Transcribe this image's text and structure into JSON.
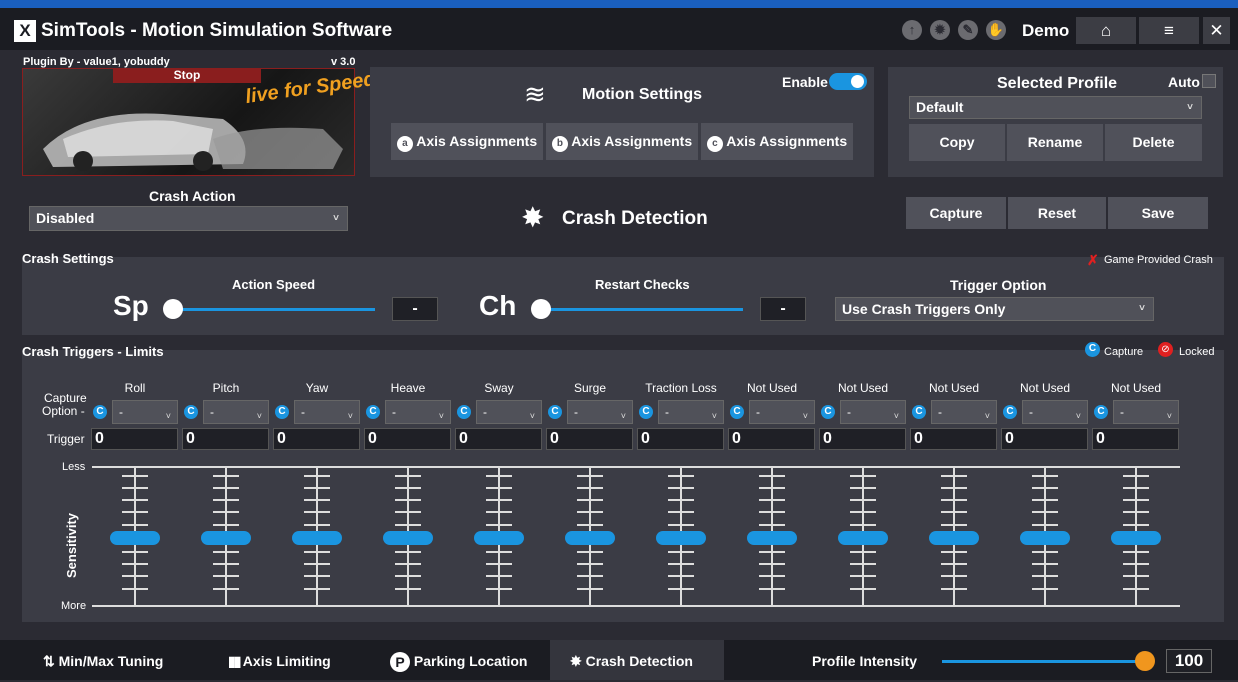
{
  "app": {
    "logo_letter": "X",
    "title": "SimTools - Motion Simulation Software",
    "user": "Demo",
    "icons": [
      "arrow-up-icon",
      "gear-icon",
      "pencil-icon",
      "hand-icon"
    ],
    "home_icon": "⌂",
    "menu_icon": "≡",
    "close_icon": "✕"
  },
  "plugin": {
    "by": "Plugin By - value1, yobuddy",
    "version": "v 3.0",
    "status": "Stop",
    "logo_text": "live for Speed"
  },
  "motion": {
    "title": "Motion Settings",
    "enable_label": "Enable",
    "enabled": true,
    "axis_buttons": [
      {
        "letter": "a",
        "label": "Axis Assignments"
      },
      {
        "letter": "b",
        "label": "Axis Assignments"
      },
      {
        "letter": "c",
        "label": "Axis Assignments"
      }
    ]
  },
  "profile": {
    "title": "Selected Profile",
    "auto_label": "Auto",
    "selected": "Default",
    "buttons": {
      "copy": "Copy",
      "rename": "Rename",
      "delete": "Delete"
    }
  },
  "crash_action": {
    "label": "Crash Action",
    "selected": "Disabled"
  },
  "crash_detection_title": "Crash Detection",
  "actions": {
    "capture": "Capture",
    "reset": "Reset",
    "save": "Save"
  },
  "crash_settings": {
    "title": "Crash Settings",
    "game_provided": "Game Provided Crash",
    "action_speed": {
      "label": "Action Speed",
      "abbr": "Sp",
      "value": "-"
    },
    "restart_checks": {
      "label": "Restart Checks",
      "abbr": "Ch",
      "value": "-"
    },
    "trigger_option": {
      "label": "Trigger Option",
      "selected": "Use Crash Triggers Only"
    }
  },
  "triggers": {
    "title": "Crash Triggers - Limits",
    "legend_capture": "Capture",
    "legend_locked": "Locked",
    "capture_option_label_1": "Capture",
    "capture_option_label_2": "Option -",
    "trigger_label": "Trigger",
    "less": "Less",
    "more": "More",
    "sensitivity": "Sensitivity",
    "columns": [
      {
        "name": "Roll",
        "option": "-",
        "trigger": "0"
      },
      {
        "name": "Pitch",
        "option": "-",
        "trigger": "0"
      },
      {
        "name": "Yaw",
        "option": "-",
        "trigger": "0"
      },
      {
        "name": "Heave",
        "option": "-",
        "trigger": "0"
      },
      {
        "name": "Sway",
        "option": "-",
        "trigger": "0"
      },
      {
        "name": "Surge",
        "option": "-",
        "trigger": "0"
      },
      {
        "name": "Traction Loss",
        "option": "-",
        "trigger": "0"
      },
      {
        "name": "Not Used",
        "option": "-",
        "trigger": "0"
      },
      {
        "name": "Not Used",
        "option": "-",
        "trigger": "0"
      },
      {
        "name": "Not Used",
        "option": "-",
        "trigger": "0"
      },
      {
        "name": "Not Used",
        "option": "-",
        "trigger": "0"
      },
      {
        "name": "Not Used",
        "option": "-",
        "trigger": "0"
      }
    ]
  },
  "bottom": {
    "tabs": [
      {
        "icon": "⇅",
        "label": "Min/Max Tuning"
      },
      {
        "icon": "▮▮",
        "label": "Axis Limiting"
      },
      {
        "icon": "P",
        "label": "Parking Location"
      },
      {
        "icon": "✸",
        "label": "Crash Detection"
      }
    ],
    "intensity_label": "Profile Intensity",
    "intensity_value": "100"
  },
  "colors": {
    "accent": "#1a95e0",
    "slider_knob": "#f0961e",
    "locked": "#e02020"
  }
}
